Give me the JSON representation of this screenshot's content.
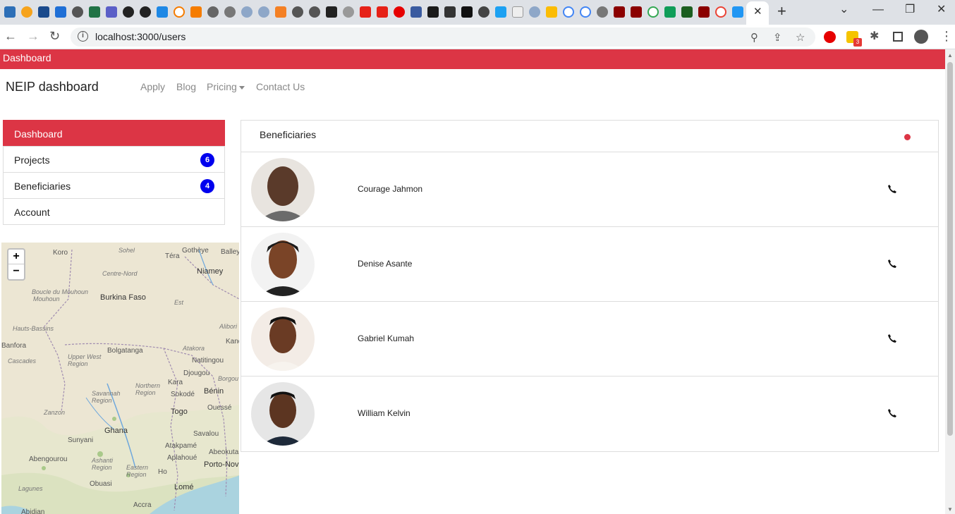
{
  "browser": {
    "url": "localhost:3000/users",
    "close_tab_label": "✕",
    "new_tab_label": "+",
    "extension_badge": "3"
  },
  "app": {
    "top_bar_label": "Dashboard",
    "brand": "NEIP dashboard",
    "nav": [
      "Apply",
      "Blog",
      "Pricing",
      "Contact Us"
    ]
  },
  "sidebar": {
    "items": [
      {
        "label": "Dashboard"
      },
      {
        "label": "Projects",
        "badge": "6"
      },
      {
        "label": "Beneficiaries",
        "badge": "4"
      },
      {
        "label": "Account"
      }
    ]
  },
  "map": {
    "zoom_in": "+",
    "zoom_out": "−",
    "labels": [
      "Koro",
      "Sohel",
      "Téra",
      "Gothèye",
      "Balley",
      "Niamey",
      "Centre-Nord",
      "Boucle du Mouhoun",
      "Burkina Faso",
      "Est",
      "Hauts-Bassins",
      "Alibori",
      "Kandi",
      "Banfora",
      "Bolgatanga",
      "Atakora",
      "Natitingou",
      "Cascades",
      "Upper West Region",
      "Djougou",
      "Borgou",
      "Kara",
      "Northern Region",
      "Savannah Region",
      "Sokodé",
      "Bénin",
      "Zanzon",
      "Togo",
      "Ouessé",
      "Ghana",
      "Savalou",
      "Sunyani",
      "Atakpamé",
      "Abeokuta",
      "Abengourou",
      "Ashanti Region",
      "Aplahoué",
      "Porto-Novo",
      "Eastern Region",
      "Ho",
      "Lagunes",
      "Obuasi",
      "Lomé",
      "Accra",
      "Abidjan",
      "Mouhoun"
    ]
  },
  "panel": {
    "title": "Beneficiaries",
    "beneficiaries": [
      {
        "name": "Courage Jahmon"
      },
      {
        "name": "Denise Asante"
      },
      {
        "name": "Gabriel Kumah"
      },
      {
        "name": "William Kelvin"
      }
    ]
  },
  "colors": {
    "accent": "#dc3545",
    "badge": "#0000ee"
  }
}
